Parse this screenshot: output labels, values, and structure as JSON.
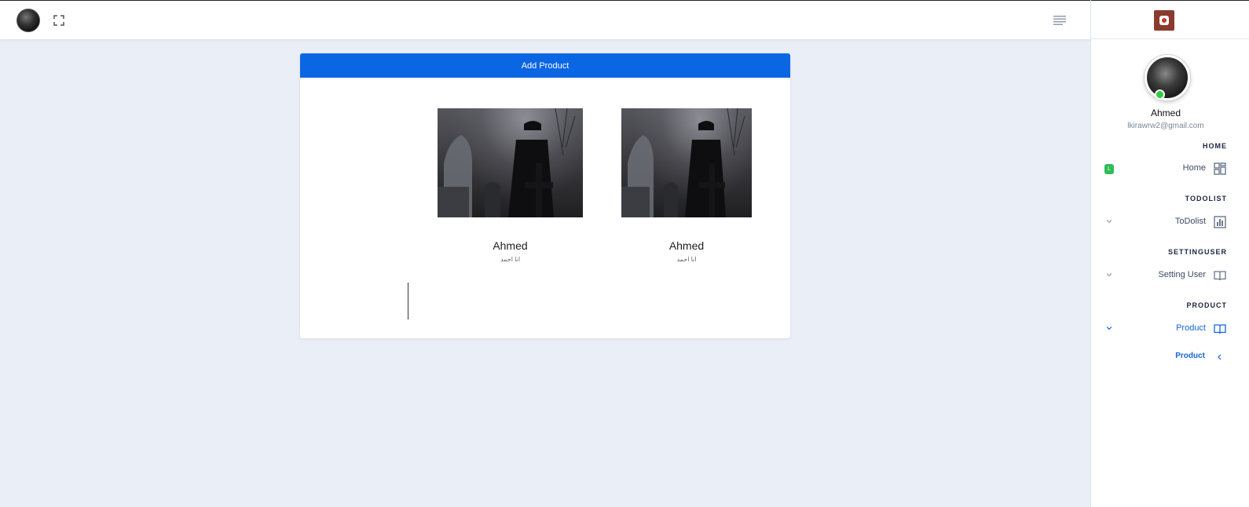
{
  "topbar": {
    "avatar_icon": "user-avatar",
    "fullscreen_icon": "fullscreen-icon",
    "menu_icon": "hamburger-menu-icon"
  },
  "main": {
    "add_button_label": "Add Product",
    "products": [
      {
        "name": "Ahmed",
        "description": "انا احمد",
        "image_icon": "product-image"
      },
      {
        "name": "Ahmed",
        "description": "انا احمد",
        "image_icon": "product-image"
      }
    ]
  },
  "sidebar": {
    "logo_icon": "app-logo",
    "profile": {
      "name": "Ahmed",
      "email": "lkirawrw2@gmail.com",
      "status_color": "#2ecc40"
    },
    "sections": [
      {
        "heading": "HOME",
        "item": {
          "label": "Home",
          "icon": "dashboard-grid-icon",
          "badge": "L"
        }
      },
      {
        "heading": "TODOLIST",
        "item": {
          "label": "ToDolist",
          "icon": "bar-chart-icon"
        }
      },
      {
        "heading": "SETTINGUSER",
        "item": {
          "label": "Setting User",
          "icon": "book-icon"
        }
      },
      {
        "heading": "PRODUCT",
        "item": {
          "label": "Product",
          "icon": "book-icon"
        },
        "submenu": [
          "Product"
        ]
      }
    ]
  },
  "colors": {
    "accent": "#0b66e4",
    "background": "#eaeef7",
    "active_link": "#1565d8",
    "badge": "#2ebd59"
  }
}
